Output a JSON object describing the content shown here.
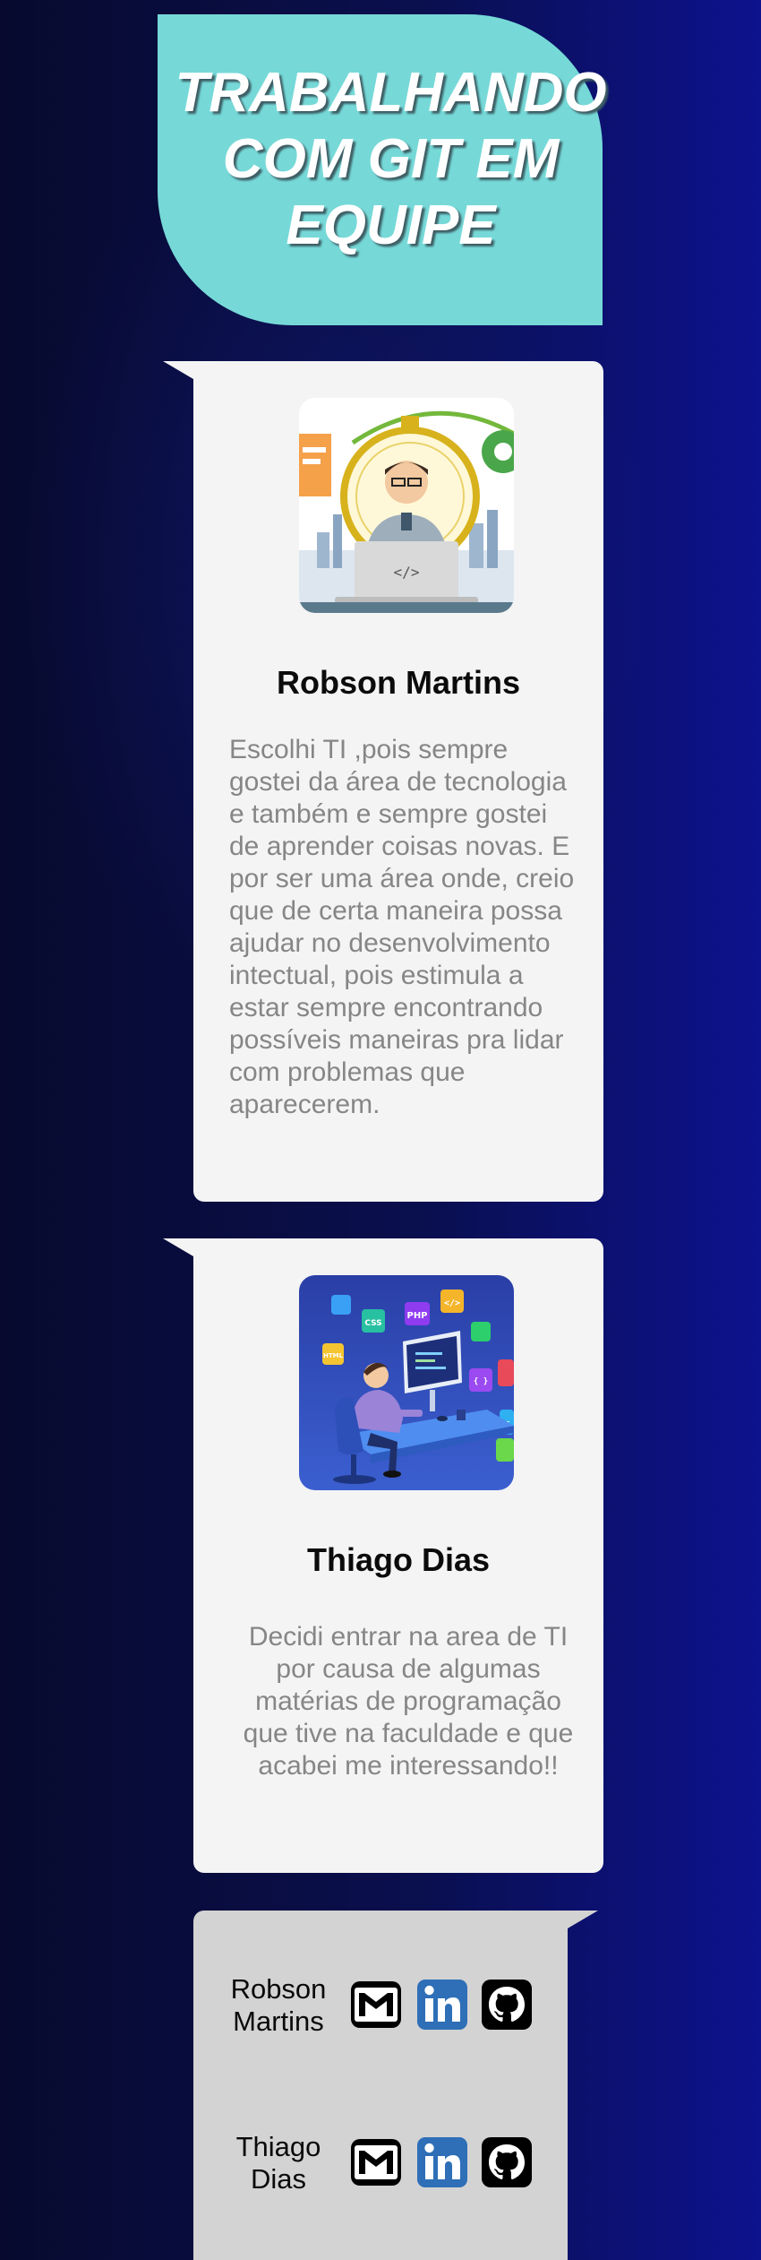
{
  "header": {
    "title": "TRABALHANDO COM GIT EM EQUIPE"
  },
  "members": [
    {
      "name": "Robson Martins",
      "bio": "Escolhi TI ,pois sempre gostei da área de tecnologia e também e sempre gostei de aprender coisas novas. E por ser uma área onde, creio que de certa maneira possa ajudar no desenvolvimento intectual, pois estimula a estar sempre encontrando possíveis maneiras pra lidar com problemas que aparecerem.",
      "avatar_icon": "developer-laptop-stopwatch-illustration",
      "avatar_code_label": "</>"
    },
    {
      "name": "Thiago Dias",
      "bio": "Decidi entrar na area de TI por causa de algumas matérias de programação que tive na faculdade e que acabei me interessando!!",
      "avatar_icon": "developer-desk-tech-icons-illustration",
      "avatar_badges": [
        "PHP",
        "CSS",
        "</>",
        "HTML",
        "{ }",
        "JS"
      ]
    }
  ],
  "contacts": [
    {
      "name": "Robson Martins",
      "links": [
        "gmail-icon",
        "linkedin-icon",
        "github-icon"
      ]
    },
    {
      "name": "Thiago Dias",
      "links": [
        "gmail-icon",
        "linkedin-icon",
        "github-icon"
      ]
    }
  ],
  "colors": {
    "background": "#070a2e",
    "title_box": "#76d9d8",
    "card": "#f4f4f4",
    "contacts_panel": "#d3d3d3",
    "bio_text": "#868686",
    "linkedin_blue": "#2e6fb7"
  }
}
